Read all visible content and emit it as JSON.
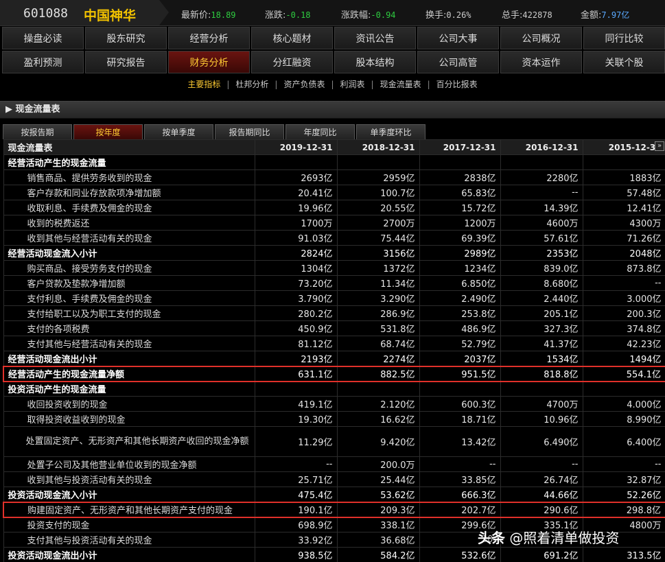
{
  "header": {
    "code": "601088",
    "name": "中国神华",
    "quotes": [
      {
        "label": "最新价:",
        "value": "18.89"
      },
      {
        "label": "涨跌:",
        "value": "-0.18"
      },
      {
        "label": "涨跌幅:",
        "value": "-0.94"
      },
      {
        "label": "换手:",
        "value": "0.26%"
      },
      {
        "label": "总手:",
        "value": "422878"
      },
      {
        "label": "金额:",
        "value": "7.97亿"
      }
    ],
    "colors": {
      "name": "#f2c200",
      "down": "#2ecc40",
      "amount": "#5aa9ff"
    }
  },
  "nav_row1": [
    "操盘必读",
    "股东研究",
    "经营分析",
    "核心题材",
    "资讯公告",
    "公司大事",
    "公司概况",
    "同行比较"
  ],
  "nav_row2": [
    "盈利预测",
    "研究报告",
    "财务分析",
    "分红融资",
    "股本结构",
    "公司高管",
    "资本运作",
    "关联个股"
  ],
  "nav_active": "财务分析",
  "subnav": [
    "主要指标",
    "杜邦分析",
    "资产负债表",
    "利润表",
    "现金流量表",
    "百分比报表"
  ],
  "subnav_active": "主要指标",
  "section_title": "现金流量表",
  "section_arrow": "▶",
  "tabs": [
    "按报告期",
    "按年度",
    "按单季度",
    "报告期同比",
    "年度同比",
    "单季度环比"
  ],
  "tab_active": "按年度",
  "table": {
    "corner": "现金流量表",
    "columns": [
      "2019-12-31",
      "2018-12-31",
      "2017-12-31",
      "2016-12-31",
      "2015-12-31"
    ],
    "scroll_label": "»",
    "rows": [
      {
        "label": "经营活动产生的现金流量",
        "bold": true,
        "values": [
          "",
          "",
          "",
          "",
          ""
        ]
      },
      {
        "label": "销售商品、提供劳务收到的现金",
        "values": [
          "2693亿",
          "2959亿",
          "2838亿",
          "2280亿",
          "1883亿"
        ]
      },
      {
        "label": "客户存款和同业存放款项净增加额",
        "values": [
          "20.41亿",
          "100.7亿",
          "65.83亿",
          "--",
          "57.48亿"
        ]
      },
      {
        "label": "收取利息、手续费及佣金的现金",
        "values": [
          "19.96亿",
          "20.55亿",
          "15.72亿",
          "14.39亿",
          "12.41亿"
        ]
      },
      {
        "label": "收到的税费返还",
        "values": [
          "1700万",
          "2700万",
          "1200万",
          "4600万",
          "4300万"
        ]
      },
      {
        "label": "收到其他与经营活动有关的现金",
        "values": [
          "91.03亿",
          "75.44亿",
          "69.39亿",
          "57.61亿",
          "71.26亿"
        ]
      },
      {
        "label": "经营活动现金流入小计",
        "bold": true,
        "values": [
          "2824亿",
          "3156亿",
          "2989亿",
          "2353亿",
          "2048亿"
        ]
      },
      {
        "label": "购买商品、接受劳务支付的现金",
        "values": [
          "1304亿",
          "1372亿",
          "1234亿",
          "839.0亿",
          "873.8亿"
        ]
      },
      {
        "label": "客户贷款及垫款净增加额",
        "values": [
          "73.20亿",
          "11.34亿",
          "6.850亿",
          "8.680亿",
          "--"
        ]
      },
      {
        "label": "支付利息、手续费及佣金的现金",
        "values": [
          "3.790亿",
          "3.290亿",
          "2.490亿",
          "2.440亿",
          "3.000亿"
        ]
      },
      {
        "label": "支付给职工以及为职工支付的现金",
        "values": [
          "280.2亿",
          "286.9亿",
          "253.8亿",
          "205.1亿",
          "200.3亿"
        ]
      },
      {
        "label": "支付的各项税费",
        "values": [
          "450.9亿",
          "531.8亿",
          "486.9亿",
          "327.3亿",
          "374.8亿"
        ]
      },
      {
        "label": "支付其他与经营活动有关的现金",
        "values": [
          "81.12亿",
          "68.74亿",
          "52.79亿",
          "41.37亿",
          "42.23亿"
        ]
      },
      {
        "label": "经营活动现金流出小计",
        "bold": true,
        "values": [
          "2193亿",
          "2274亿",
          "2037亿",
          "1534亿",
          "1494亿"
        ]
      },
      {
        "label": "经营活动产生的现金流量净额",
        "bold": true,
        "highlight": true,
        "values": [
          "631.1亿",
          "882.5亿",
          "951.5亿",
          "818.8亿",
          "554.1亿"
        ]
      },
      {
        "label": "投资活动产生的现金流量",
        "bold": true,
        "values": [
          "",
          "",
          "",
          "",
          ""
        ]
      },
      {
        "label": "收回投资收到的现金",
        "values": [
          "419.1亿",
          "2.120亿",
          "600.3亿",
          "4700万",
          "4.000亿"
        ]
      },
      {
        "label": "取得投资收益收到的现金",
        "values": [
          "19.30亿",
          "16.62亿",
          "18.71亿",
          "10.96亿",
          "8.990亿"
        ]
      },
      {
        "label": "处置固定资产、无形资产和其他长期资产收回的现金净额",
        "tall": true,
        "values": [
          "11.29亿",
          "9.420亿",
          "13.42亿",
          "6.490亿",
          "6.400亿"
        ]
      },
      {
        "label": "处置子公司及其他营业单位收到的现金净额",
        "values": [
          "--",
          "200.0万",
          "--",
          "--",
          "--"
        ]
      },
      {
        "label": "收到其他与投资活动有关的现金",
        "values": [
          "25.71亿",
          "25.44亿",
          "33.85亿",
          "26.74亿",
          "32.87亿"
        ]
      },
      {
        "label": "投资活动现金流入小计",
        "bold": true,
        "values": [
          "475.4亿",
          "53.62亿",
          "666.3亿",
          "44.66亿",
          "52.26亿"
        ]
      },
      {
        "label": "购建固定资产、无形资产和其他长期资产支付的现金",
        "highlight": true,
        "values": [
          "190.1亿",
          "209.3亿",
          "202.7亿",
          "290.6亿",
          "298.8亿"
        ]
      },
      {
        "label": "投资支付的现金",
        "values": [
          "698.9亿",
          "338.1亿",
          "299.6亿",
          "335.1亿",
          "4800万"
        ]
      },
      {
        "label": "支付其他与投资活动有关的现金",
        "values": [
          "33.92亿",
          "36.68亿",
          "30.",
          "",
          ""
        ]
      },
      {
        "label": "投资活动现金流出小计",
        "bold": true,
        "values": [
          "938.5亿",
          "584.2亿",
          "532.6亿",
          "691.2亿",
          "313.5亿"
        ]
      }
    ]
  },
  "watermark": {
    "brand": "头条",
    "text": "@照着清单做投资"
  }
}
